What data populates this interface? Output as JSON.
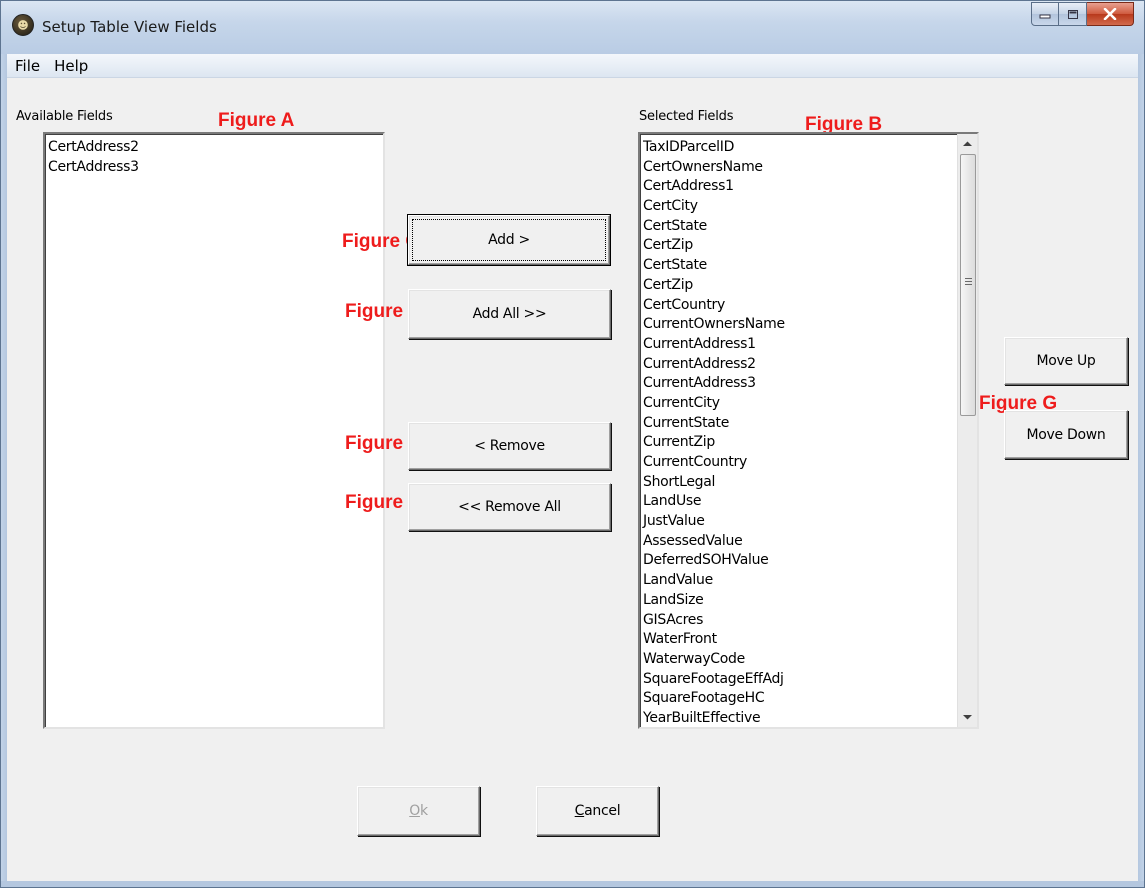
{
  "window": {
    "title": "Setup Table View Fields",
    "app_icon": "app-icon"
  },
  "menu": {
    "items": [
      "File",
      "Help"
    ]
  },
  "available": {
    "label": "Available Fields",
    "items": [
      "CertAddress2",
      "CertAddress3"
    ]
  },
  "selected": {
    "label": "Selected Fields",
    "items": [
      "TaxIDParcelID",
      "CertOwnersName",
      "CertAddress1",
      "CertCity",
      "CertState",
      "CertZip",
      "CertState",
      "CertZip",
      "CertCountry",
      "CurrentOwnersName",
      "CurrentAddress1",
      "CurrentAddress2",
      "CurrentAddress3",
      "CurrentCity",
      "CurrentState",
      "CurrentZip",
      "CurrentCountry",
      "ShortLegal",
      "LandUse",
      "JustValue",
      "AssessedValue",
      "DeferredSOHValue",
      "LandValue",
      "LandSize",
      "GISAcres",
      "WaterFront",
      "WaterwayCode",
      "SquareFootageEffAdj",
      "SquareFootageHC",
      "YearBuiltEffective"
    ]
  },
  "buttons": {
    "add": "Add >",
    "add_all": "Add All >>",
    "remove": "< Remove",
    "remove_all": "<< Remove All",
    "move_up": "Move Up",
    "move_down": "Move Down",
    "ok_mnemonic": "O",
    "ok_rest": "k",
    "cancel_mnemonic": "C",
    "cancel_rest": "ancel"
  },
  "annotations": {
    "a": "Figure A",
    "b": "Figure B",
    "c": "Figure C",
    "d": "Figure D",
    "e": "Figure E",
    "f": "Figure F",
    "g": "Figure G"
  },
  "colors": {
    "annotation": "#ee1c1c",
    "close_button": "#c9462a",
    "dialog_background": "#f0f0f0"
  },
  "icons": [
    "minimize-icon",
    "maximize-icon",
    "close-icon",
    "scroll-up-arrow-icon",
    "scroll-down-arrow-icon"
  ]
}
